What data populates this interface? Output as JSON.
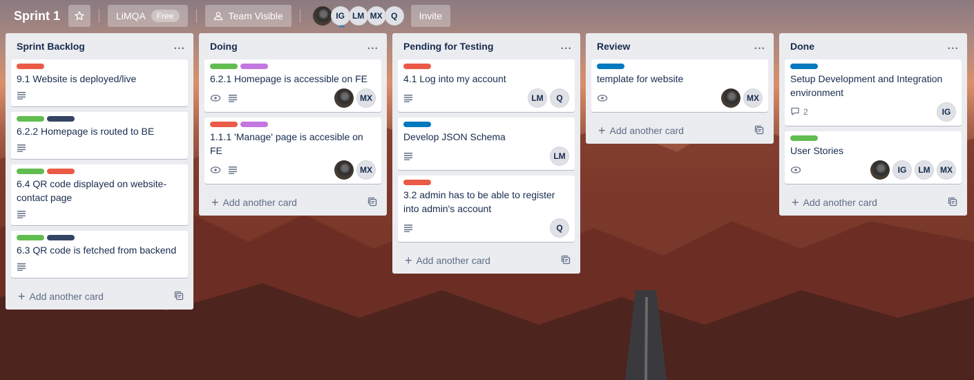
{
  "header": {
    "board_title": "Sprint 1",
    "star_icon": "star-icon",
    "workspace": "LiMQA",
    "workspace_badge": "Free",
    "visibility_icon": "team-icon",
    "visibility": "Team Visible",
    "members": [
      {
        "initials": "",
        "photo": true
      },
      {
        "initials": "IG",
        "admin": true
      },
      {
        "initials": "LM"
      },
      {
        "initials": "MX"
      },
      {
        "initials": "Q"
      }
    ],
    "invite": "Invite"
  },
  "colors": {
    "green": "#61bd4f",
    "red": "#eb5a46",
    "purple": "#c377e0",
    "navy": "#344563",
    "blue": "#0079bf"
  },
  "lists": [
    {
      "title": "Sprint Backlog",
      "menu": "...",
      "add_card": "Add another card",
      "cards": [
        {
          "labels": [
            "red"
          ],
          "title": "9.1 Website is deployed/live",
          "watch": false,
          "desc": true,
          "comments": "",
          "members": []
        },
        {
          "labels": [
            "green",
            "navy"
          ],
          "title": "6.2.2 Homepage is routed to BE",
          "watch": false,
          "desc": true,
          "comments": "",
          "members": []
        },
        {
          "labels": [
            "green",
            "red"
          ],
          "title": "6.4 QR code displayed on website-contact page",
          "watch": false,
          "desc": true,
          "comments": "",
          "members": []
        },
        {
          "labels": [
            "green",
            "navy"
          ],
          "title": "6.3 QR code is fetched from backend",
          "watch": false,
          "desc": true,
          "comments": "",
          "members": []
        }
      ]
    },
    {
      "title": "Doing",
      "menu": "...",
      "add_card": "Add another card",
      "cards": [
        {
          "labels": [
            "green",
            "purple"
          ],
          "title": "6.2.1 Homepage is accessible on FE",
          "watch": true,
          "desc": true,
          "comments": "",
          "members": [
            "photo",
            "MX"
          ]
        },
        {
          "labels": [
            "red",
            "purple"
          ],
          "title": "1.1.1 'Manage' page is accesible on FE",
          "watch": true,
          "desc": true,
          "comments": "",
          "members": [
            "photo",
            "MX"
          ]
        }
      ]
    },
    {
      "title": "Pending for Testing",
      "menu": "...",
      "add_card": "Add another card",
      "cards": [
        {
          "labels": [
            "red"
          ],
          "title": "4.1 Log into my account",
          "watch": false,
          "desc": true,
          "comments": "",
          "members": [
            "LM",
            "Q"
          ]
        },
        {
          "labels": [
            "blue"
          ],
          "title": "Develop JSON Schema",
          "watch": false,
          "desc": true,
          "comments": "",
          "members": [
            "LM"
          ]
        },
        {
          "labels": [
            "red"
          ],
          "title": "3.2 admin has to be able to register into admin's account",
          "watch": false,
          "desc": true,
          "comments": "",
          "members": [
            "Q"
          ]
        }
      ]
    },
    {
      "title": "Review",
      "menu": "...",
      "add_card": "Add another card",
      "cards": [
        {
          "labels": [
            "blue"
          ],
          "title": "template for website",
          "watch": true,
          "desc": false,
          "comments": "",
          "members": [
            "photo",
            "MX"
          ]
        }
      ]
    },
    {
      "title": "Done",
      "menu": "...",
      "add_card": "Add another card",
      "cards": [
        {
          "labels": [
            "blue"
          ],
          "title": "Setup Development and Integration environment",
          "watch": false,
          "desc": false,
          "comments": "2",
          "members": [
            "IG"
          ]
        },
        {
          "labels": [
            "green"
          ],
          "title": "User Stories",
          "watch": true,
          "desc": false,
          "comments": "",
          "members": [
            "photo",
            "IG",
            "LM",
            "MX"
          ]
        }
      ]
    }
  ]
}
